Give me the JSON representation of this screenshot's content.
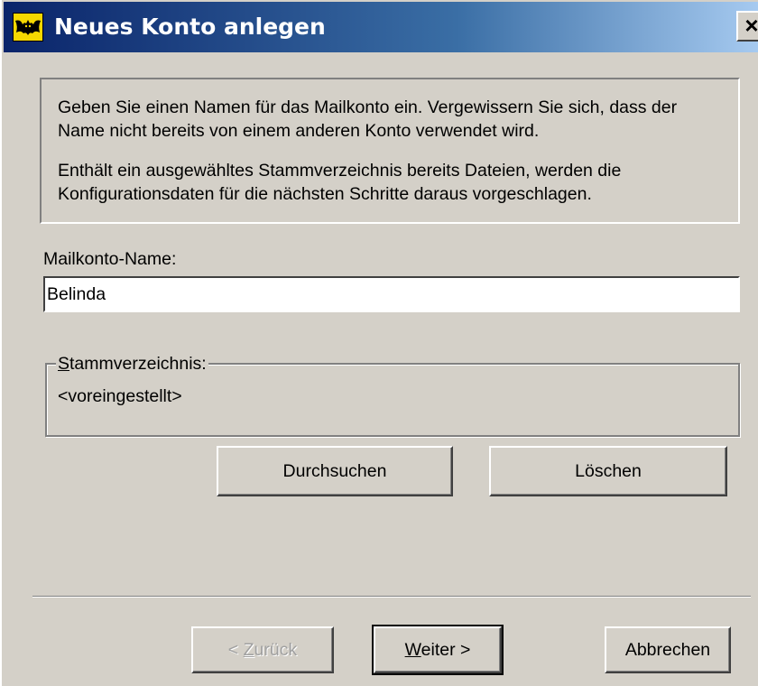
{
  "window": {
    "title": "Neues Konto anlegen",
    "close_label": "×",
    "icon": "bat-icon"
  },
  "info": {
    "paragraph1": "Geben Sie einen Namen für das Mailkonto ein. Vergewissern Sie sich, dass der Name nicht bereits von einem anderen Konto verwendet wird.",
    "paragraph2": "Enthält ein ausgewähltes Stammverzeichnis bereits Dateien, werden die Konfigurationsdaten für die nächsten Schritte daraus vorgeschlagen."
  },
  "account": {
    "name_label": "Mailkonto-Name:",
    "name_value": "Belinda"
  },
  "root_dir": {
    "legend_first": "S",
    "legend_rest": "tammverzeichnis:",
    "value": "<voreingestellt>"
  },
  "actions": {
    "browse_label": "Durchsuchen",
    "delete_label": "Löschen"
  },
  "wizard": {
    "back_prefix": "< ",
    "back_mnemonic": "Z",
    "back_rest": "urück",
    "next_mnemonic": "W",
    "next_rest": "eiter >",
    "cancel_label": "Abbrechen"
  },
  "colors": {
    "face": "#d4d0c8",
    "title_start": "#0a246a",
    "title_end": "#a6caf0",
    "disabled_text": "#a0a0a0"
  }
}
